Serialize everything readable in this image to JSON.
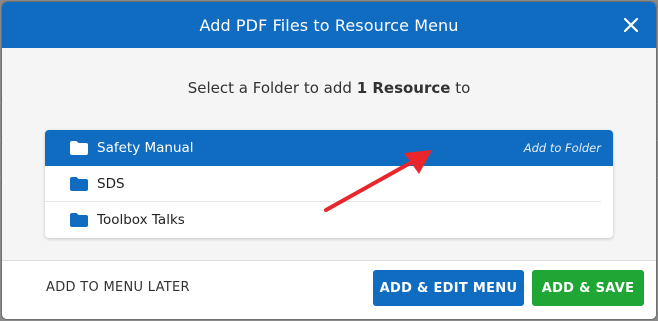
{
  "modal": {
    "title": "Add PDF Files to Resource Menu",
    "close_icon": "close-icon"
  },
  "prompt": {
    "prefix": "Select a Folder to add ",
    "count": "1 Resource",
    "suffix": " to"
  },
  "folders": [
    {
      "label": "Safety Manual",
      "selected": true,
      "action": "Add to Folder",
      "icon": "folder-icon"
    },
    {
      "label": "SDS",
      "selected": false,
      "icon": "folder-icon"
    },
    {
      "label": "Toolbox Talks",
      "selected": false,
      "icon": "folder-icon"
    }
  ],
  "footer": {
    "later_label": "ADD TO MENU LATER",
    "edit_label": "ADD & EDIT MENU",
    "save_label": "ADD & SAVE"
  },
  "colors": {
    "header": "#0f6cc1",
    "selected_row": "#0f6cc1",
    "folder_icon": "#0f6cc1",
    "edit_button": "#0f6cc1",
    "save_button": "#1fa635",
    "annotation_arrow": "#e8262b"
  }
}
